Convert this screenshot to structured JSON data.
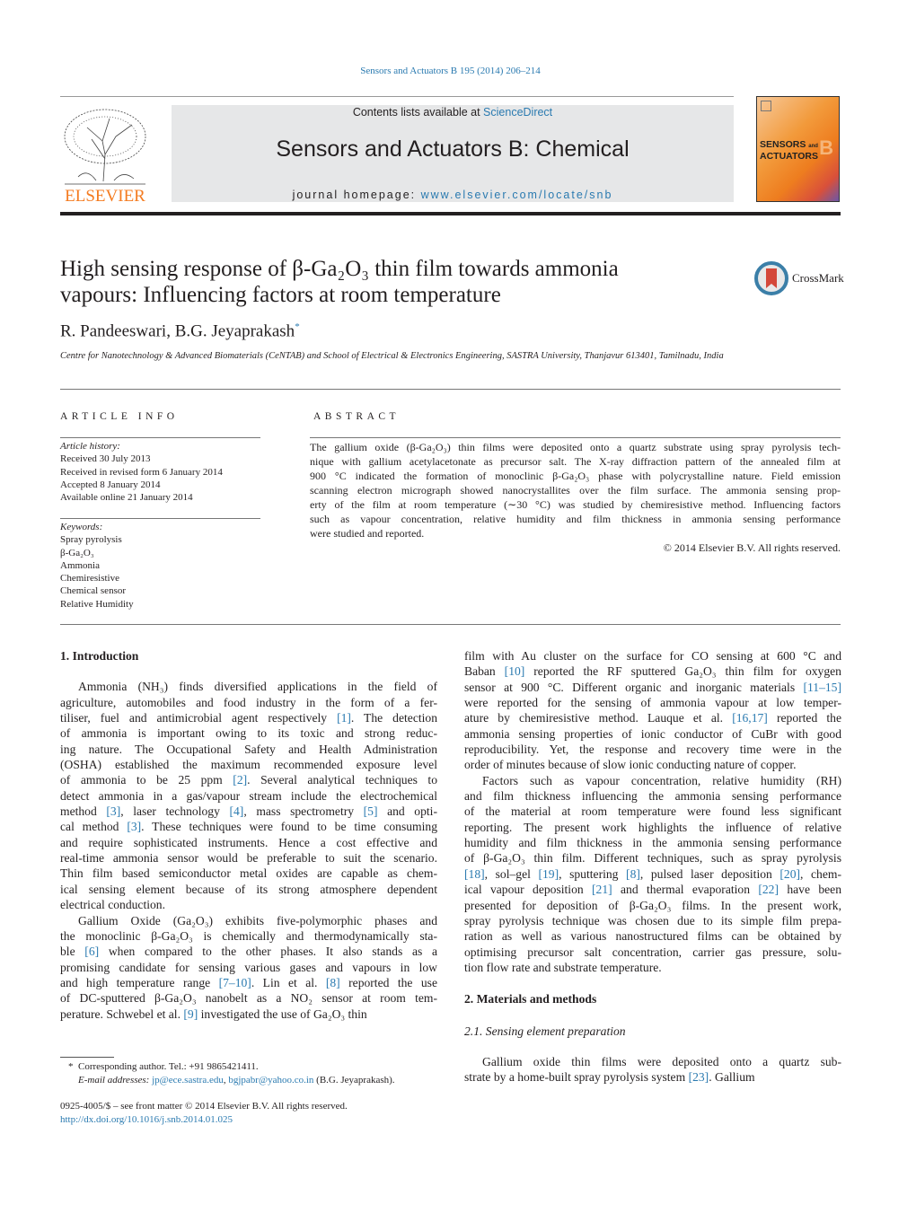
{
  "header": {
    "journal_ref": "Sensors and Actuators B 195 (2014) 206–214",
    "contents_prefix": "Contents lists available at ",
    "contents_link": "ScienceDirect",
    "journal_title": "Sensors and Actuators B: Chemical",
    "homepage_prefix": "journal homepage: ",
    "homepage_link": "www.elsevier.com/locate/snb",
    "publisher_logo": "ELSEVIER",
    "cover_text": "SENSORS and ACTUATORS B",
    "crossmark": "CrossMark"
  },
  "article": {
    "title_lines": [
      "High sensing response of β-Ga₂O₃ thin film towards ammonia",
      "vapours: Influencing factors at room temperature"
    ],
    "authors": "R. Pandeeswari, B.G. Jeyaprakash",
    "author_mark": "*",
    "affiliation": "Centre for Nanotechnology & Advanced Biomaterials (CeNTAB) and School of Electrical & Electronics Engineering, SASTRA University, Thanjavur 613401, Tamilnadu, India"
  },
  "article_info": {
    "heading": "ARTICLE INFO",
    "history_label": "Article history:",
    "history": [
      "Received 30 July 2013",
      "Received in revised form 6 January 2014",
      "Accepted 8 January 2014",
      "Available online 21 January 2014"
    ],
    "keywords_label": "Keywords:",
    "keywords": [
      "Spray pyrolysis",
      "β-Ga₂O₃",
      "Ammonia",
      "Chemiresistive",
      "Chemical sensor",
      "Relative Humidity"
    ]
  },
  "abstract": {
    "heading": "ABSTRACT",
    "lines": [
      "The gallium oxide (β-Ga₂O₃) thin films were deposited onto a quartz substrate using spray pyrolysis tech-",
      "nique with gallium acetylacetonate as precursor salt. The X-ray diffraction pattern of the annealed film at",
      "900 °C indicated the formation of monoclinic β-Ga₂O₃ phase with polycrystalline nature. Field emission",
      "scanning electron micrograph showed nanocrystallites over the film surface. The ammonia sensing prop-",
      "erty of the film at room temperature (∼30 °C) was studied by chemiresistive method. Influencing factors",
      "such as vapour concentration, relative humidity and film thickness in ammonia sensing performance",
      "were studied and reported."
    ],
    "copyright": "© 2014 Elsevier B.V. All rights reserved."
  },
  "body": {
    "intro_heading": "1.  Introduction",
    "left_paragraphs": [
      [
        "Ammonia (NH₃) finds diversified applications in the field of",
        "agriculture, automobiles and food industry in the form of a fer-",
        "tiliser, fuel and antimicrobial agent respectively [1]. The detection",
        "of ammonia is important owing to its toxic and strong reduc-",
        "ing nature. The Occupational Safety and Health Administration",
        "(OSHA) established the maximum recommended exposure level",
        "of ammonia to be 25 ppm [2]. Several analytical techniques to",
        "detect ammonia in a gas/vapour stream include the electrochemical",
        "method [3], laser technology [4], mass spectrometry [5] and opti-",
        "cal method [3]. These techniques were found to be time consuming",
        "and require sophisticated instruments. Hence a cost effective and",
        "real-time ammonia sensor would be preferable to suit the scenario.",
        "Thin film based semiconductor metal oxides are capable as chem-",
        "ical sensing element because of its strong atmosphere dependent",
        "electrical conduction."
      ],
      [
        "Gallium Oxide (Ga₂O₃) exhibits five-polymorphic phases and",
        "the monoclinic β-Ga₂O₃ is chemically and thermodynamically sta-",
        "ble [6] when compared to the other phases. It also stands as a",
        "promising candidate for sensing various gases and vapours in low",
        "and high temperature range [7–10]. Lin et al. [8] reported the use",
        "of DC-sputtered β-Ga₂O₃ nanobelt as a NO₂ sensor at room tem-",
        "perature. Schwebel et al. [9] investigated the use of Ga₂O₃ thin"
      ]
    ],
    "right_paragraphs": [
      [
        "film with Au cluster on the surface for CO sensing at 600 °C and",
        "Baban [10] reported the RF sputtered Ga₂O₃ thin film for oxygen",
        "sensor at 900 °C. Different organic and inorganic materials [11–15]",
        "were reported for the sensing of ammonia vapour at low temper-",
        "ature by chemiresistive method. Lauque et al. [16,17] reported the",
        "ammonia sensing properties of ionic conductor of CuBr with good",
        "reproducibility. Yet, the response and recovery time were in the",
        "order of minutes because of slow ionic conducting nature of copper."
      ],
      [
        "Factors such as vapour concentration, relative humidity (RH)",
        "and film thickness influencing the ammonia sensing performance",
        "of the material at room temperature were found less significant",
        "reporting. The present work highlights the influence of relative",
        "humidity and film thickness in the ammonia sensing performance",
        "of β-Ga₂O₃ thin film. Different techniques, such as spray pyrolysis",
        "[18], sol–gel [19], sputtering [8], pulsed laser deposition [20], chem-",
        "ical vapour deposition [21] and thermal evaporation [22] have been",
        "presented for deposition of β-Ga₂O₃ films. In the present work,",
        "spray pyrolysis technique was chosen due to its simple film prepa-",
        "ration as well as various nanostructured films can be obtained by",
        "optimising precursor salt concentration, carrier gas pressure, solu-",
        "tion flow rate and substrate temperature."
      ]
    ],
    "methods_heading": "2.  Materials and methods",
    "subsection_heading": "2.1.  Sensing element preparation",
    "methods_paragraph": [
      "Gallium oxide thin films were deposited onto a quartz sub-",
      "strate by a home-built spray pyrolysis system [23]. Gallium"
    ]
  },
  "footnote": {
    "mark": "*",
    "corresponding": "Corresponding author. Tel.: +91 9865421411.",
    "email_label": "E-mail addresses:",
    "email1": "jp@ece.sastra.edu",
    "email2": "bgjpabr@yahoo.co.in",
    "email_owner": "(B.G. Jeyaprakash).",
    "issn": "0925-4005/$ – see front matter © 2014 Elsevier B.V. All rights reserved.",
    "doi": "http://dx.doi.org/10.1016/j.snb.2014.01.025"
  },
  "colors": {
    "link": "#2a7ab0",
    "elsevier_orange": "#f47b20",
    "banner_gray": "#e6e7e8"
  }
}
